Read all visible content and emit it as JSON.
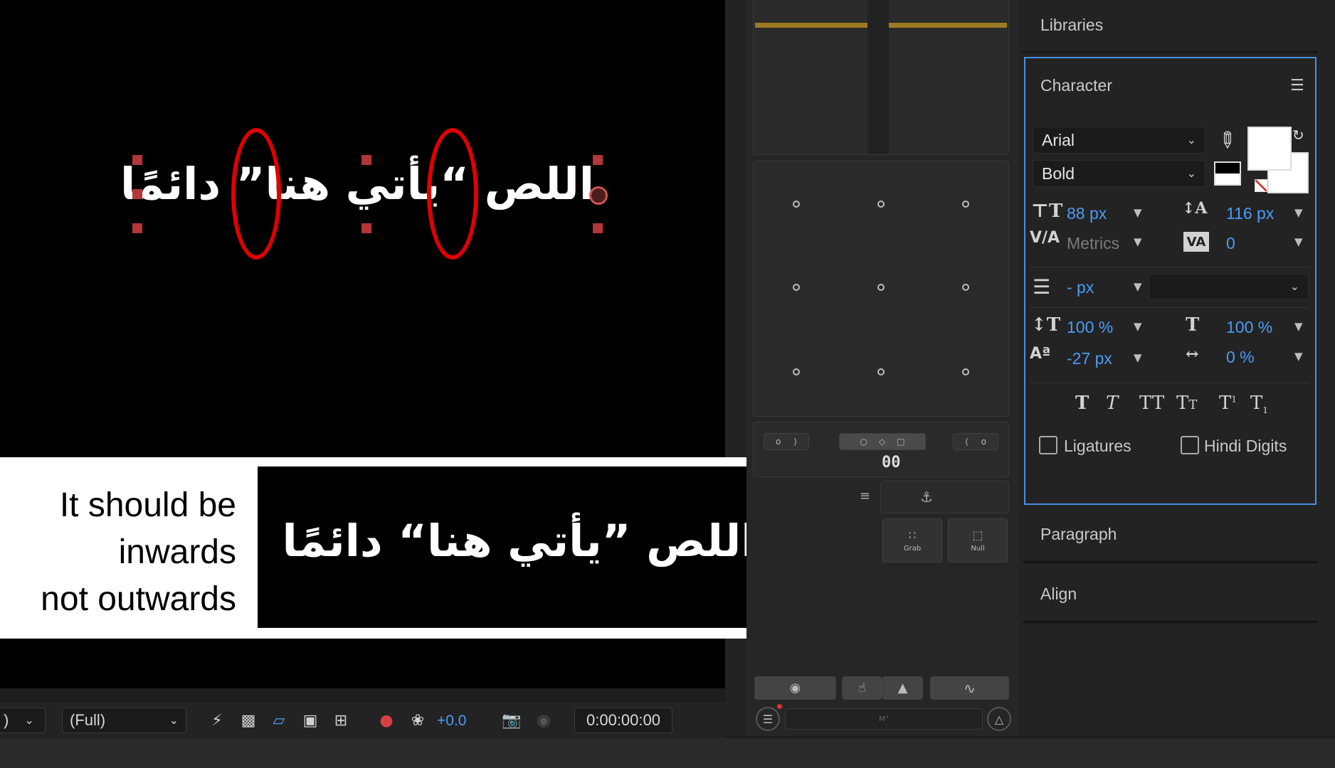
{
  "composition": {
    "arabic_line": "اللص “يأتي هنا” دائمًا",
    "corrected_line": "اللص ”يأتي هنا“ دائمًا"
  },
  "annotation": {
    "line1": "It should be",
    "line2": "inwards",
    "line3": "not outwards",
    "highlight_color": "#e00000"
  },
  "viewer_toolbar": {
    "zoom_partial": ")",
    "resolution": "(Full)",
    "exposure": "+0.0",
    "timecode": "0:00:00:00"
  },
  "mid_panel": {
    "grab_label": "Grab",
    "null_label": "Null",
    "partial_digits": "00",
    "left_toggle": "o",
    "right_toggle": "o",
    "small_field_text": "M°"
  },
  "right_panel": {
    "libraries": "Libraries",
    "character": "Character",
    "paragraph": "Paragraph",
    "align": "Align"
  },
  "character": {
    "font_family": "Arial",
    "font_style": "Bold",
    "font_size": "88 px",
    "leading": "116 px",
    "kerning": "Metrics",
    "tracking": "0",
    "stroke_width": "- px",
    "stroke_type": "",
    "vertical_scale": "100 %",
    "horizontal_scale": "100 %",
    "baseline_shift": "-27 px",
    "tsume": "0 %",
    "ligatures_label": "Ligatures",
    "hindi_digits_label": "Hindi Digits",
    "ligatures_checked": false,
    "hindi_digits_checked": false,
    "fill_color": "#ffffff",
    "accent_color": "#4a90e2"
  }
}
